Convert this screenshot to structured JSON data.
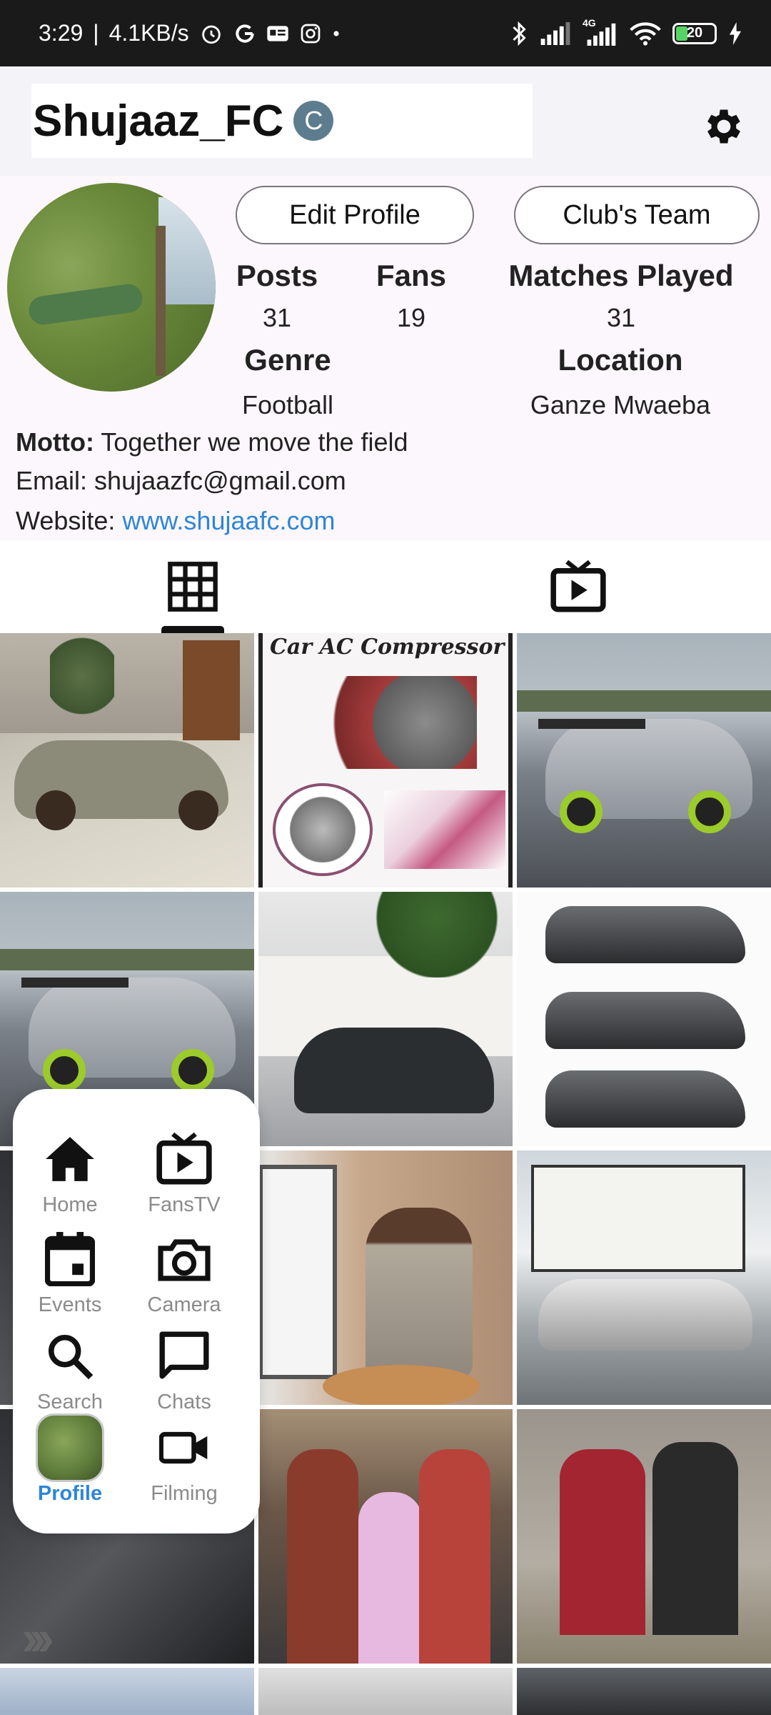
{
  "status_bar": {
    "time": "3:29",
    "speed": "4.1KB/s",
    "network": "4G",
    "battery": "20"
  },
  "header": {
    "title": "Shujaaz_FC",
    "badge": "C"
  },
  "profile": {
    "edit_button": "Edit Profile",
    "team_button": "Club's Team",
    "stats": {
      "posts_label": "Posts",
      "posts_value": "31",
      "fans_label": "Fans",
      "fans_value": "19",
      "matches_label": "Matches Played",
      "matches_value": "31",
      "genre_label": "Genre",
      "genre_value": "Football",
      "location_label": "Location",
      "location_value": "Ganze Mwaeba"
    },
    "motto_label": "Motto:",
    "motto": "Together we move the field",
    "email_label": "Email:",
    "email": "shujaazfc@gmail.com",
    "website_label": "Website:",
    "website": "www.shujaafc.com"
  },
  "grid": {
    "compressor_caption": "Car AC Compressor"
  },
  "menu": {
    "items": [
      {
        "label": "Home",
        "icon": "home-icon"
      },
      {
        "label": "FansTV",
        "icon": "tv-icon"
      },
      {
        "label": "Events",
        "icon": "calendar-icon"
      },
      {
        "label": "Camera",
        "icon": "camera-icon"
      },
      {
        "label": "Search",
        "icon": "search-icon"
      },
      {
        "label": "Chats",
        "icon": "chat-icon"
      },
      {
        "label": "Profile",
        "icon": "avatar"
      },
      {
        "label": "Filming",
        "icon": "videocam-icon"
      }
    ],
    "active": "Profile"
  },
  "colors": {
    "accent": "#2f86d6",
    "header_bg": "#f4f3f7",
    "profile_bg": "#fcf7fc",
    "badge": "#5d7d8f"
  }
}
